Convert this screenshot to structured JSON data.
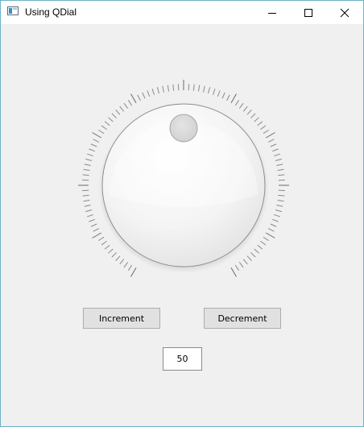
{
  "window": {
    "title": "Using QDial",
    "icon": "qt-app-window-icon",
    "controls": [
      "minimize-icon",
      "maximize-icon",
      "close-icon"
    ],
    "border_color": "#6fb3c8",
    "background": "#f0f0f0"
  },
  "dial": {
    "value": 50,
    "min": 0,
    "max": 100,
    "notches_visible": true,
    "notch_count": 101,
    "major_notch_every": 10
  },
  "buttons": {
    "increment_label": "Increment",
    "decrement_label": "Decrement"
  },
  "value_label": {
    "text": "50"
  }
}
